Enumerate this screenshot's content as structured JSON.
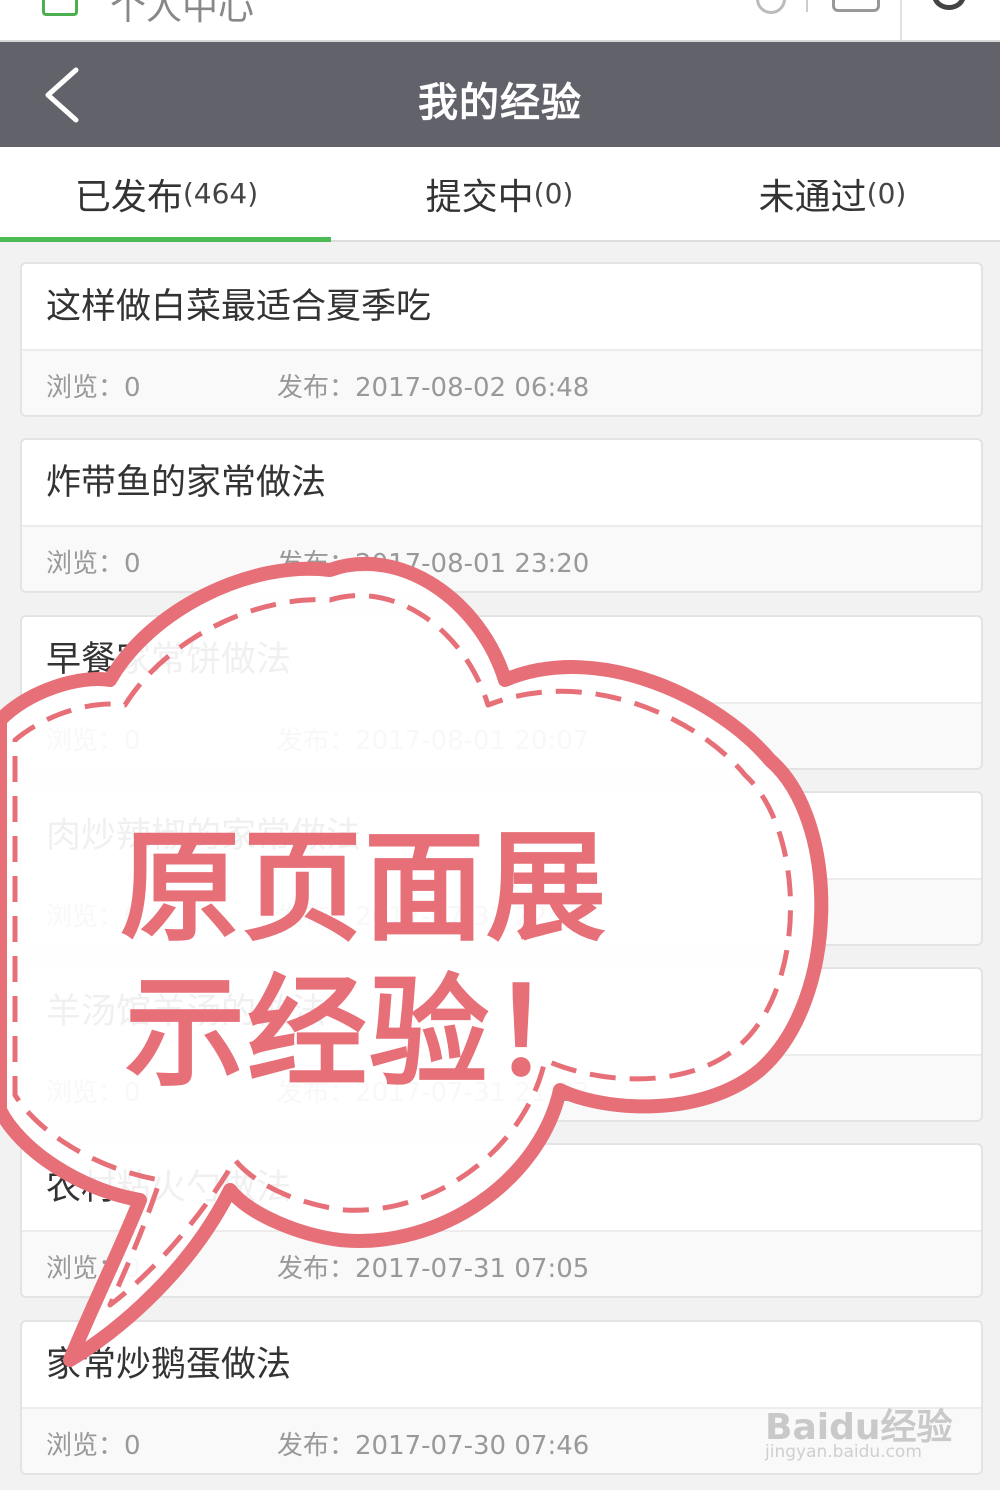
{
  "topbar": {
    "title": "个人中心"
  },
  "header": {
    "title": "我的经验",
    "back_icon": "chevron-left-icon"
  },
  "tabs": [
    {
      "label": "已发布",
      "count": "(464)",
      "active": true
    },
    {
      "label": "提交中",
      "count": "(0)",
      "active": false
    },
    {
      "label": "未通过",
      "count": "(0)",
      "active": false
    }
  ],
  "list": {
    "items": [
      {
        "title": "这样做白菜最适合夏季吃",
        "views": "浏览：0",
        "date": "发布：2017-08-02 06:48"
      },
      {
        "title": "炸带鱼的家常做法",
        "views": "浏览：0",
        "date": "发布：2017-08-01 23:20"
      },
      {
        "title": "早餐家常饼做法",
        "views": "浏览：0",
        "date": "发布：2017-08-01 20:07"
      },
      {
        "title": "肉炒辣椒的家常做法",
        "views": "浏览：0",
        "date": "发布：2017-07-31 22:53"
      },
      {
        "title": "羊汤馆羊汤的做法",
        "views": "浏览：0",
        "date": "发布：2017-07-31 21:13"
      },
      {
        "title": "农村粘火勺做法",
        "views": "浏览：0",
        "date": "发布：2017-07-31 07:05"
      },
      {
        "title": "家常炒鹅蛋做法",
        "views": "浏览：0",
        "date": "发布：2017-07-30 07:46"
      }
    ]
  },
  "overlay": {
    "line1": "原页面展",
    "line2": "示经验！",
    "color": "#e66f78"
  },
  "watermark": {
    "brand": "Baidu经验",
    "url": "jingyan.baidu.com"
  },
  "colors": {
    "header_bg": "#62626b",
    "accent": "#4cba55"
  }
}
